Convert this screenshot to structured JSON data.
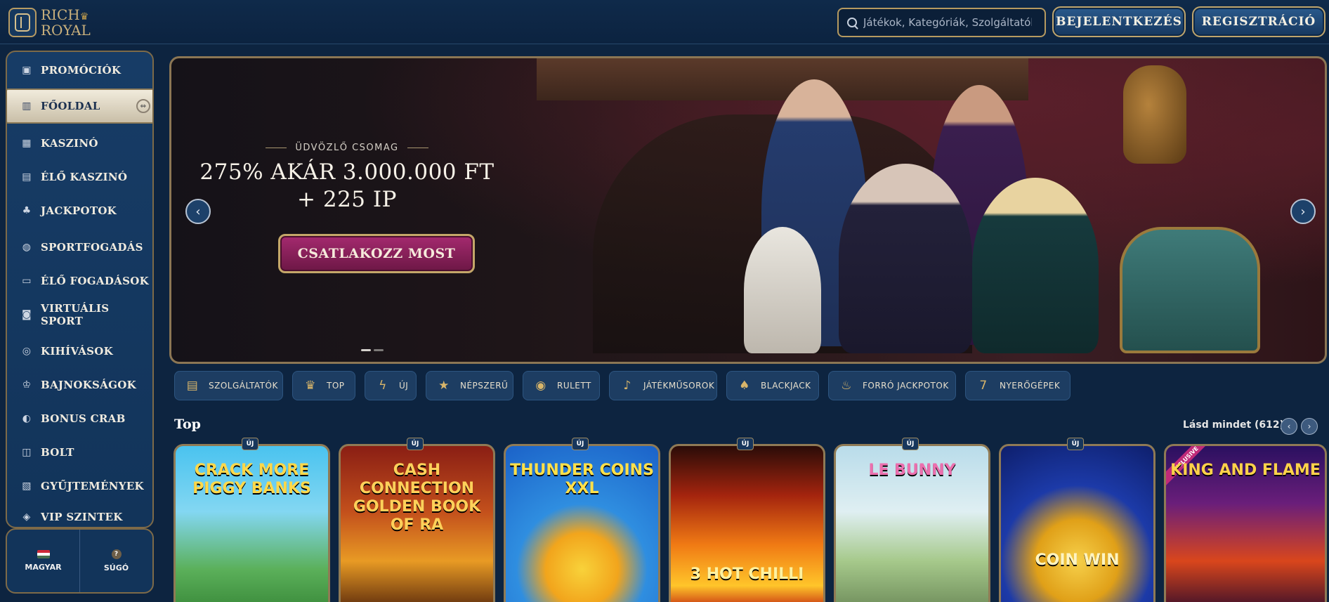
{
  "header": {
    "logo_top": "RICH",
    "logo_bottom": "ROYAL",
    "search_placeholder": "Játékok, Kategóriák, Szolgáltatók",
    "login_label": "BEJELENTKEZÉS",
    "register_label": "REGISZTRÁCIÓ"
  },
  "sidebar": {
    "items": [
      {
        "label": "PROMÓCIÓK",
        "icon": "gift-icon"
      },
      {
        "label": "FŐOLDAL",
        "icon": "bank-icon",
        "active": true
      },
      {
        "label": "KASZINÓ",
        "icon": "slot-machine-icon"
      },
      {
        "label": "ÉLŐ KASZINÓ",
        "icon": "live-casino-icon"
      },
      {
        "label": "JACKPOTOK",
        "icon": "clover-icon"
      },
      {
        "label": "SPORTFOGADÁS",
        "icon": "ball-icon"
      },
      {
        "label": "ÉLŐ FOGADÁSOK",
        "icon": "live-bets-icon"
      },
      {
        "label": "VIRTUÁLIS SPORT",
        "icon": "virtual-sport-icon"
      },
      {
        "label": "KIHÍVÁSOK",
        "icon": "target-icon"
      },
      {
        "label": "BAJNOKSÁGOK",
        "icon": "trophy-icon"
      },
      {
        "label": "BONUS CRAB",
        "icon": "crab-icon"
      },
      {
        "label": "BOLT",
        "icon": "shop-bag-icon"
      },
      {
        "label": "GYŰJTEMÉNYEK",
        "icon": "collection-icon"
      },
      {
        "label": "VIP SZINTEK",
        "icon": "vip-icon"
      }
    ],
    "language_label": "MAGYAR",
    "help_label": "SÚGÓ"
  },
  "hero": {
    "eyebrow": "ÜDVÖZLŐ CSOMAG",
    "title_line1": "275% AKÁR 3.000.000 FT",
    "title_line2": "+ 225 IP",
    "cta_label": "CSATLAKOZZ MOST"
  },
  "chips": [
    {
      "label": "SZOLGÁLTATÓK",
      "icon": "book-icon",
      "glyph": "▤"
    },
    {
      "label": "TOP",
      "icon": "crown-icon",
      "glyph": "♛"
    },
    {
      "label": "ÚJ",
      "icon": "lightning-icon",
      "glyph": "ϟ"
    },
    {
      "label": "NÉPSZERŰ",
      "icon": "star-icon",
      "glyph": "★"
    },
    {
      "label": "RULETT",
      "icon": "roulette-icon",
      "glyph": "◉"
    },
    {
      "label": "JÁTÉKMŰSOROK",
      "icon": "microphone-icon",
      "glyph": "♪"
    },
    {
      "label": "BLACKJACK",
      "icon": "cards-icon",
      "glyph": "♠"
    },
    {
      "label": "FORRÓ JACKPOTOK",
      "icon": "chili-icon",
      "glyph": "♨"
    },
    {
      "label": "NYERŐGÉPEK",
      "icon": "seven-icon",
      "glyph": "7"
    }
  ],
  "top_section": {
    "title": "Top",
    "see_all": "Lásd mindet (612)",
    "new_tag": "ÚJ",
    "exclusive_tag": "EXCLUSIVE"
  },
  "games": [
    {
      "title": "CRACK MORE PIGGY BANKS",
      "new": true
    },
    {
      "title": "CASH CONNECTION GOLDEN BOOK OF RA",
      "new": true
    },
    {
      "title": "THUNDER COINS XXL",
      "new": true
    },
    {
      "title": "3 HOT CHILLI",
      "new": true
    },
    {
      "title": "LE BUNNY",
      "new": true
    },
    {
      "title": "COIN WIN",
      "new": true
    },
    {
      "title": "KING AND FLAME",
      "new": false,
      "exclusive": true
    }
  ]
}
